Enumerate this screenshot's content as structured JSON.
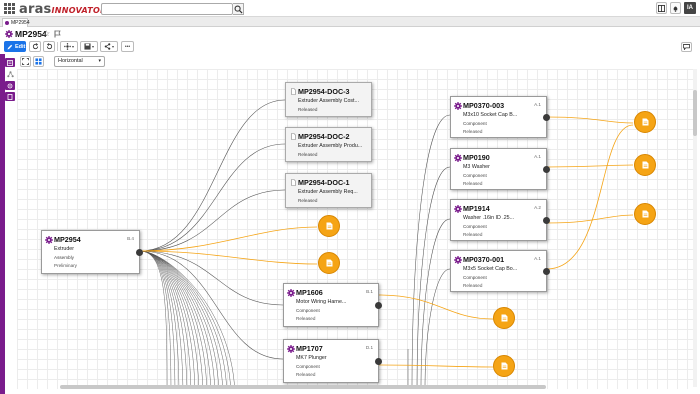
{
  "app": {
    "logo_main": "aras",
    "logo_sub": "INNOVATOR",
    "user_initials": "IA"
  },
  "search": {
    "placeholder": ""
  },
  "tab": {
    "label": "MP2954"
  },
  "item": {
    "title": "MP2954"
  },
  "toolbar": {
    "edit_label": "Edit",
    "more_label": "•••"
  },
  "view": {
    "layout_value": "Horizontal"
  },
  "colors": {
    "accent": "#7a1c8c",
    "primary": "#1a73e8",
    "file": "#f5a415",
    "file_edge": "#f5a415",
    "edge": "#4a4a4a"
  },
  "nodes": {
    "root": {
      "id": "MP2954",
      "name": "Extruder",
      "type": "Assembly",
      "state": "Preliminary",
      "rev": "B.4"
    },
    "doc3": {
      "id": "MP2954-DOC-3",
      "name": "Extruder Assembly Cost...",
      "state": "Released"
    },
    "doc2": {
      "id": "MP2954-DOC-2",
      "name": "Extruder Assembly Produ...",
      "state": "Released"
    },
    "doc1": {
      "id": "MP2954-DOC-1",
      "name": "Extruder Assembly Req...",
      "state": "Released"
    },
    "p1606": {
      "id": "MP1606",
      "name": "Motor Wiring Harne...",
      "type": "Component",
      "state": "Released",
      "rev": "B.1"
    },
    "p1707": {
      "id": "MP1707",
      "name": "MK7 Plunger",
      "type": "Component",
      "state": "Released",
      "rev": "D.1"
    },
    "p0370_003": {
      "id": "MP0370-003",
      "name": "M3x10 Socket Cap B...",
      "type": "Component",
      "state": "Released",
      "rev": "A.1"
    },
    "p0190": {
      "id": "MP0190",
      "name": "M3 Washer",
      "type": "Component",
      "state": "Released",
      "rev": "A.1"
    },
    "p1914": {
      "id": "MP1914",
      "name": "Washer .16in ID .25...",
      "type": "Component",
      "state": "Released",
      "rev": "A.2"
    },
    "p0370_001": {
      "id": "MP0370-001",
      "name": "M3x5 Socket Cap Bo...",
      "type": "Component",
      "state": "Released",
      "rev": "A.1"
    }
  }
}
